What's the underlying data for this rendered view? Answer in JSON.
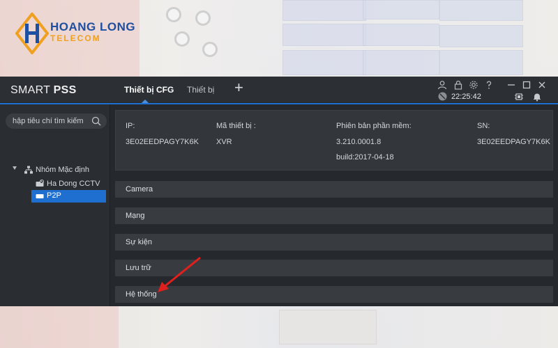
{
  "logo": {
    "line1": "HOANG LONG",
    "line2": "TELECOM"
  },
  "app": {
    "brand_prefix": "SMART ",
    "brand_bold": "PSS",
    "tabs": [
      {
        "label": "Thiết bị CFG",
        "active": true
      },
      {
        "label": "Thiết bị",
        "active": false
      }
    ],
    "add_tab_label": "+",
    "clock": "22:25:42"
  },
  "sidebar": {
    "search_placeholder": "hập tiêu chí tìm kiếm",
    "tree": {
      "group_label": "Nhóm Mặc định",
      "items": [
        {
          "label": "Ha Dong CCTV",
          "selected": false
        },
        {
          "label": "P2P",
          "selected": true
        }
      ]
    }
  },
  "device_info": {
    "ip_label": "IP:",
    "ip_value": "3E02EEDPAGY7K6K",
    "model_label": "Mã thiết bị :",
    "model_value": "XVR",
    "version_label": "Phiên bản phần mềm:",
    "version_value": "3.210.0001.8",
    "version_build": "build:2017-04-18",
    "sn_label": "SN:",
    "sn_value": "3E02EEDPAGY7K6K"
  },
  "sections": [
    {
      "label": "Camera"
    },
    {
      "label": "Mạng"
    },
    {
      "label": "Sự kiện"
    },
    {
      "label": "Lưu trữ"
    },
    {
      "label": "Hệ thống"
    }
  ],
  "colors": {
    "accent": "#1f6fd1",
    "window_bg": "#2a2d32",
    "annotation_arrow": "#e0201c"
  }
}
